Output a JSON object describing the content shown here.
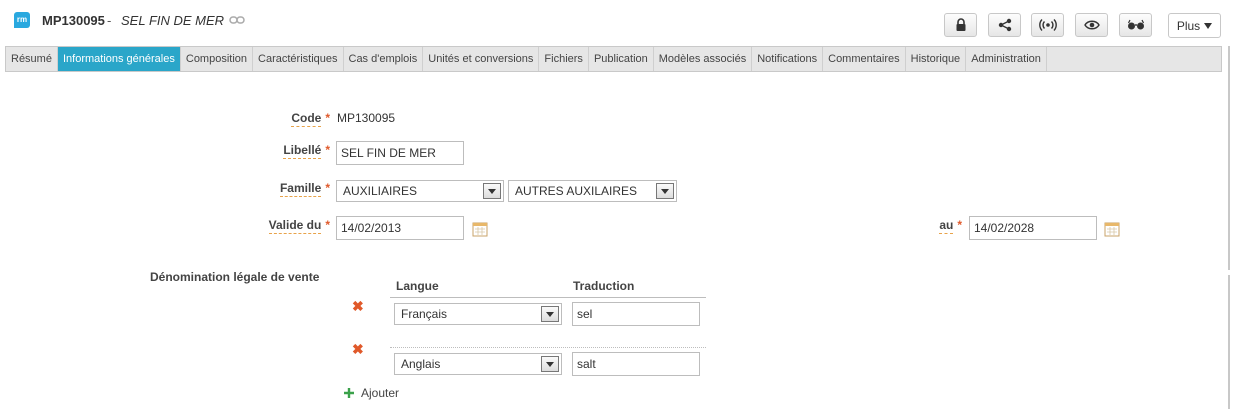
{
  "header": {
    "logo_text": "rm",
    "code": "MP130095",
    "separator": "-",
    "name": "SEL FIN DE MER",
    "plus_label": "Plus"
  },
  "toolbar": {
    "icons": [
      "lock-icon",
      "share-icon",
      "broadcast-icon",
      "eye-icon",
      "glasses-icon"
    ]
  },
  "tabs": [
    "Résumé",
    "Informations générales",
    "Composition",
    "Caractéristiques",
    "Cas d'emplois",
    "Unités et conversions",
    "Fichiers",
    "Publication",
    "Modèles associés",
    "Notifications",
    "Commentaires",
    "Historique",
    "Administration"
  ],
  "active_tab_index": 1,
  "form": {
    "code_label": "Code",
    "code_value": "MP130095",
    "libelle_label": "Libellé",
    "libelle_value": "SEL FIN DE MER",
    "famille_label": "Famille",
    "famille_value": "AUXILIAIRES",
    "sous_famille_value": "AUTRES AUXILAIRES",
    "valide_du_label": "Valide du",
    "valide_du_value": "14/02/2013",
    "au_label": "au",
    "au_value": "14/02/2028",
    "required_mark": "*"
  },
  "denomination": {
    "label": "Dénomination légale de vente",
    "col_langue": "Langue",
    "col_traduction": "Traduction",
    "rows": [
      {
        "langue": "Français",
        "traduction": "sel"
      },
      {
        "langue": "Anglais",
        "traduction": "salt"
      }
    ],
    "add_label": "Ajouter"
  },
  "colors": {
    "accent": "#2aa6c9",
    "required": "#e05a2c",
    "delete": "#e0592a",
    "add": "#3aa14a"
  }
}
